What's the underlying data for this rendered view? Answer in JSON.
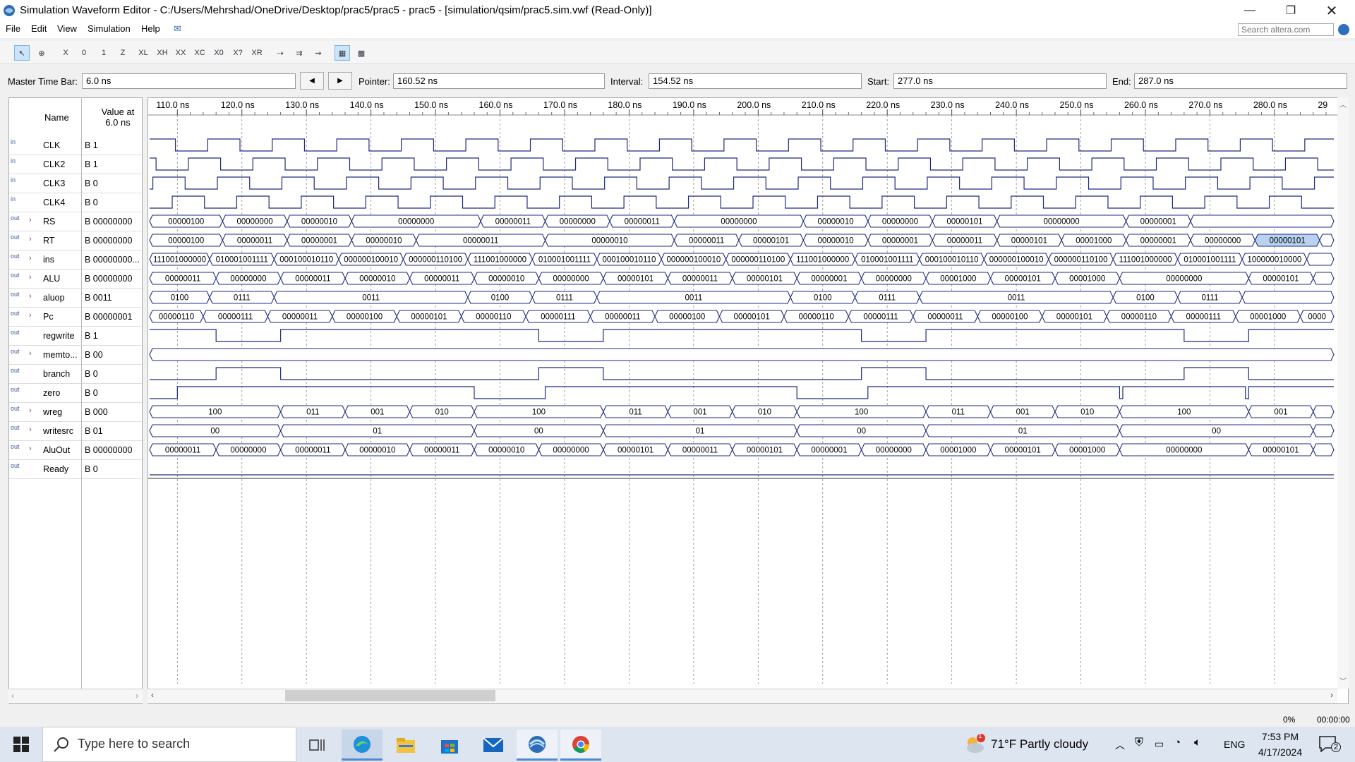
{
  "window": {
    "title": "Simulation Waveform Editor - C:/Users/Mehrshad/OneDrive/Desktop/prac5/prac5 - prac5 - [simulation/qsim/prac5.sim.vwf (Read-Only)]"
  },
  "menu": [
    "File",
    "Edit",
    "View",
    "Simulation",
    "Help"
  ],
  "search": {
    "placeholder": "Search altera.com"
  },
  "timebar": {
    "master_label": "Master Time Bar:",
    "master_value": "6.0 ns",
    "pointer_label": "Pointer:",
    "pointer_value": "160.52 ns",
    "interval_label": "Interval:",
    "interval_value": "154.52 ns",
    "start_label": "Start:",
    "start_value": "277.0 ns",
    "end_label": "End:",
    "end_value": "287.0 ns"
  },
  "table": {
    "name_header": "Name",
    "value_header_1": "Value at",
    "value_header_2": "6.0 ns"
  },
  "time_axis": {
    "labels": [
      "110.0 ns",
      "120.0 ns",
      "130.0 ns",
      "140.0 ns",
      "150.0 ns",
      "160.0 ns",
      "170.0 ns",
      "180.0 ns",
      "190.0 ns",
      "200.0 ns",
      "210.0 ns",
      "220.0 ns",
      "230.0 ns",
      "240.0 ns",
      "250.0 ns",
      "260.0 ns",
      "270.0 ns",
      "280.0 ns",
      "29"
    ],
    "start_ns": 105.7,
    "end_ns": 289.2
  },
  "signals": [
    {
      "dir": "in",
      "name": "CLK",
      "value": "B 1",
      "type": "clock",
      "period": 10,
      "phase": 4.0,
      "start_high": true,
      "expand": false
    },
    {
      "dir": "in",
      "name": "CLK2",
      "value": "B 1",
      "type": "clock",
      "period": 10,
      "phase": 1.0,
      "start_high": true,
      "expand": false
    },
    {
      "dir": "in",
      "name": "CLK3",
      "value": "B 0",
      "type": "clock",
      "period": 10,
      "phase": 0.5,
      "start_high": false,
      "expand": false
    },
    {
      "dir": "in",
      "name": "CLK4",
      "value": "B 0",
      "type": "clock",
      "period": 10,
      "phase": 3.5,
      "start_high": false,
      "expand": false
    },
    {
      "dir": "out",
      "name": "RS",
      "value": "B 00000000",
      "type": "bus",
      "expand": true,
      "segments": [
        [
          105.7,
          117,
          "00000100"
        ],
        [
          117,
          127,
          "00000000"
        ],
        [
          127,
          137,
          "00000010"
        ],
        [
          137,
          157,
          "00000000"
        ],
        [
          157,
          167,
          "00000011"
        ],
        [
          167,
          177,
          "00000000"
        ],
        [
          177,
          187,
          "00000011"
        ],
        [
          187,
          207,
          "00000000"
        ],
        [
          207,
          217,
          "00000010"
        ],
        [
          217,
          227,
          "00000000"
        ],
        [
          227,
          237,
          "00000101"
        ],
        [
          237,
          257,
          "00000000"
        ],
        [
          257,
          267,
          "00000001"
        ],
        [
          267,
          289.2,
          ""
        ]
      ]
    },
    {
      "dir": "out",
      "name": "RT",
      "value": "B 00000000",
      "type": "bus",
      "expand": true,
      "segments": [
        [
          105.7,
          117,
          "00000100"
        ],
        [
          117,
          127,
          "00000011"
        ],
        [
          127,
          137,
          "00000001"
        ],
        [
          137,
          147,
          "00000010"
        ],
        [
          147,
          167,
          "00000011"
        ],
        [
          167,
          187,
          "00000010"
        ],
        [
          187,
          197,
          "00000011"
        ],
        [
          197,
          207,
          "00000101"
        ],
        [
          207,
          217,
          "00000010"
        ],
        [
          217,
          227,
          "00000001"
        ],
        [
          227,
          237,
          "00000011"
        ],
        [
          237,
          247,
          "00000101"
        ],
        [
          247,
          257,
          "00001000"
        ],
        [
          257,
          267,
          "00000001"
        ],
        [
          267,
          277,
          "00000000"
        ],
        [
          277,
          287,
          "00000101"
        ],
        [
          287,
          289.2,
          ""
        ]
      ]
    },
    {
      "dir": "out",
      "name": "ins",
      "value": "B 00000000...",
      "type": "bus",
      "expand": true,
      "segments": [
        [
          105.7,
          115,
          "111001000000"
        ],
        [
          115,
          125,
          "010001001111"
        ],
        [
          125,
          135,
          "000100010110"
        ],
        [
          135,
          145,
          "000000100010"
        ],
        [
          145,
          155,
          "000000110100"
        ],
        [
          155,
          165,
          "111001000000"
        ],
        [
          165,
          175,
          "010001001111"
        ],
        [
          175,
          185,
          "000100010110"
        ],
        [
          185,
          195,
          "000000100010"
        ],
        [
          195,
          205,
          "000000110100"
        ],
        [
          205,
          215,
          "111001000000"
        ],
        [
          215,
          225,
          "010001001111"
        ],
        [
          225,
          235,
          "000100010110"
        ],
        [
          235,
          245,
          "000000100010"
        ],
        [
          245,
          255,
          "000000110100"
        ],
        [
          255,
          265,
          "111001000000"
        ],
        [
          265,
          275,
          "010001001111"
        ],
        [
          275,
          285,
          "100000010000"
        ],
        [
          285,
          289.2,
          ""
        ]
      ]
    },
    {
      "dir": "out",
      "name": "ALU",
      "value": "B 00000000",
      "type": "bus",
      "expand": true,
      "segments": [
        [
          105.7,
          116,
          "00000011"
        ],
        [
          116,
          126,
          "00000000"
        ],
        [
          126,
          136,
          "00000011"
        ],
        [
          136,
          146,
          "00000010"
        ],
        [
          146,
          156,
          "00000011"
        ],
        [
          156,
          166,
          "00000010"
        ],
        [
          166,
          176,
          "00000000"
        ],
        [
          176,
          186,
          "00000101"
        ],
        [
          186,
          196,
          "00000011"
        ],
        [
          196,
          206,
          "00000101"
        ],
        [
          206,
          216,
          "00000001"
        ],
        [
          216,
          226,
          "00000000"
        ],
        [
          226,
          236,
          "00001000"
        ],
        [
          236,
          246,
          "00000101"
        ],
        [
          246,
          256,
          "00001000"
        ],
        [
          256,
          276,
          "00000000"
        ],
        [
          276,
          286,
          "00000101"
        ],
        [
          286,
          289.2,
          ""
        ]
      ]
    },
    {
      "dir": "out",
      "name": "aluop",
      "value": "B 0011",
      "type": "bus",
      "expand": true,
      "segments": [
        [
          105.7,
          115,
          "0100"
        ],
        [
          115,
          125,
          "0111"
        ],
        [
          125,
          155,
          "0011"
        ],
        [
          155,
          165,
          "0100"
        ],
        [
          165,
          175,
          "0111"
        ],
        [
          175,
          205,
          "0011"
        ],
        [
          205,
          215,
          "0100"
        ],
        [
          215,
          225,
          "0111"
        ],
        [
          225,
          255,
          "0011"
        ],
        [
          255,
          265,
          "0100"
        ],
        [
          265,
          275,
          "0111"
        ],
        [
          275,
          289.2,
          ""
        ]
      ]
    },
    {
      "dir": "out",
      "name": "Pc",
      "value": "B 00000001",
      "type": "bus",
      "expand": true,
      "segments": [
        [
          105.7,
          114,
          "00000110"
        ],
        [
          114,
          124,
          "00000111"
        ],
        [
          124,
          134,
          "00000011"
        ],
        [
          134,
          144,
          "00000100"
        ],
        [
          144,
          154,
          "00000101"
        ],
        [
          154,
          164,
          "00000110"
        ],
        [
          164,
          174,
          "00000111"
        ],
        [
          174,
          184,
          "00000011"
        ],
        [
          184,
          194,
          "00000100"
        ],
        [
          194,
          204,
          "00000101"
        ],
        [
          204,
          214,
          "00000110"
        ],
        [
          214,
          224,
          "00000111"
        ],
        [
          224,
          234,
          "00000011"
        ],
        [
          234,
          244,
          "00000100"
        ],
        [
          244,
          254,
          "00000101"
        ],
        [
          254,
          264,
          "00000110"
        ],
        [
          264,
          274,
          "00000111"
        ],
        [
          274,
          284,
          "00001000"
        ],
        [
          284,
          289.2,
          "0000"
        ]
      ]
    },
    {
      "dir": "out",
      "name": "regwrite",
      "value": "B 1",
      "type": "bit",
      "expand": false,
      "transitions": [
        [
          105.7,
          1
        ],
        [
          116,
          0
        ],
        [
          126,
          1
        ],
        [
          166,
          0
        ],
        [
          176,
          1
        ],
        [
          216,
          0
        ],
        [
          226,
          1
        ],
        [
          266,
          0
        ],
        [
          276,
          1
        ]
      ]
    },
    {
      "dir": "out",
      "name": "memto...",
      "value": "B 00",
      "type": "bus",
      "expand": true,
      "segments": [
        [
          105.7,
          289.2,
          ""
        ]
      ]
    },
    {
      "dir": "out",
      "name": "branch",
      "value": "B 0",
      "type": "bit",
      "expand": false,
      "transitions": [
        [
          105.7,
          0
        ],
        [
          116,
          1
        ],
        [
          126,
          0
        ],
        [
          166,
          1
        ],
        [
          176,
          0
        ],
        [
          216,
          1
        ],
        [
          226,
          0
        ],
        [
          266,
          1
        ],
        [
          276,
          0
        ]
      ]
    },
    {
      "dir": "out",
      "name": "zero",
      "value": "B 0",
      "type": "bit",
      "expand": false,
      "transitions": [
        [
          105.7,
          0
        ],
        [
          110,
          1
        ],
        [
          156,
          0
        ],
        [
          167,
          1
        ],
        [
          206,
          0
        ],
        [
          217,
          1
        ],
        [
          256,
          0
        ],
        [
          256.5,
          1
        ],
        [
          275.5,
          0
        ],
        [
          276,
          1
        ]
      ]
    },
    {
      "dir": "out",
      "name": "wreg",
      "value": "B 000",
      "type": "bus",
      "expand": true,
      "segments": [
        [
          105.7,
          126,
          "100"
        ],
        [
          126,
          136,
          "011"
        ],
        [
          136,
          146,
          "001"
        ],
        [
          146,
          156,
          "010"
        ],
        [
          156,
          176,
          "100"
        ],
        [
          176,
          186,
          "011"
        ],
        [
          186,
          196,
          "001"
        ],
        [
          196,
          206,
          "010"
        ],
        [
          206,
          226,
          "100"
        ],
        [
          226,
          236,
          "011"
        ],
        [
          236,
          246,
          "001"
        ],
        [
          246,
          256,
          "010"
        ],
        [
          256,
          276,
          "100"
        ],
        [
          276,
          286,
          "001"
        ],
        [
          286,
          289.2,
          ""
        ]
      ]
    },
    {
      "dir": "out",
      "name": "writesrc",
      "value": "B 01",
      "type": "bus",
      "expand": true,
      "segments": [
        [
          105.7,
          126,
          "00"
        ],
        [
          126,
          156,
          "01"
        ],
        [
          156,
          176,
          "00"
        ],
        [
          176,
          206,
          "01"
        ],
        [
          206,
          226,
          "00"
        ],
        [
          226,
          256,
          "01"
        ],
        [
          256,
          286,
          "00"
        ],
        [
          286,
          289.2,
          ""
        ]
      ]
    },
    {
      "dir": "out",
      "name": "AluOut",
      "value": "B 00000000",
      "type": "bus",
      "expand": true,
      "segments": [
        [
          105.7,
          116,
          "00000011"
        ],
        [
          116,
          126,
          "00000000"
        ],
        [
          126,
          136,
          "00000011"
        ],
        [
          136,
          146,
          "00000010"
        ],
        [
          146,
          156,
          "00000011"
        ],
        [
          156,
          166,
          "00000010"
        ],
        [
          166,
          176,
          "00000000"
        ],
        [
          176,
          186,
          "00000101"
        ],
        [
          186,
          196,
          "00000011"
        ],
        [
          196,
          206,
          "00000101"
        ],
        [
          206,
          216,
          "00000001"
        ],
        [
          216,
          226,
          "00000000"
        ],
        [
          226,
          236,
          "00001000"
        ],
        [
          236,
          246,
          "00000101"
        ],
        [
          246,
          256,
          "00001000"
        ],
        [
          256,
          276,
          "00000000"
        ],
        [
          276,
          286,
          "00000101"
        ],
        [
          286,
          289.2,
          ""
        ]
      ]
    },
    {
      "dir": "out",
      "name": "Ready",
      "value": "B 0",
      "type": "bit",
      "expand": false,
      "transitions": [
        [
          105.7,
          0
        ]
      ]
    }
  ],
  "colors": {
    "wave": "#1f2a80",
    "grid": "#8a8a8a",
    "highlight": "#b7d3ef"
  },
  "status": {
    "percent": "0%",
    "time": "00:00:00"
  },
  "taskbar": {
    "search_placeholder": "Type here to search",
    "weather": "71°F  Partly cloudy",
    "weather_badge": "1",
    "lang": "ENG",
    "time": "7:53 PM",
    "date": "4/17/2024",
    "notif_count": "2"
  }
}
